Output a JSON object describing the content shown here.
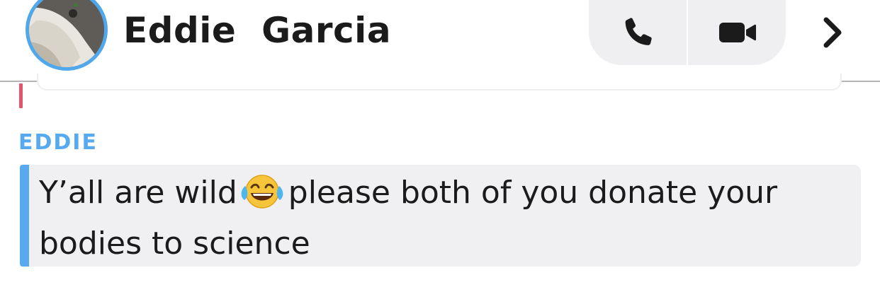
{
  "header": {
    "contact_name": "Eddie  Garcia",
    "avatar_icon": "profile-photo",
    "avatar_ring_color": "#4fa8ec",
    "call_icon": "phone-icon",
    "video_icon": "video-camera-icon",
    "more_icon": "chevron-right-icon"
  },
  "chat": {
    "previous_message_accent": "#e0566a",
    "sender": "EDDIE",
    "sender_color": "#58aaf0",
    "message_before_emoji": "Y’all are wild",
    "emoji": "face-with-tears-of-joy",
    "message_after_emoji": "please both of you donate your bodies to science"
  }
}
